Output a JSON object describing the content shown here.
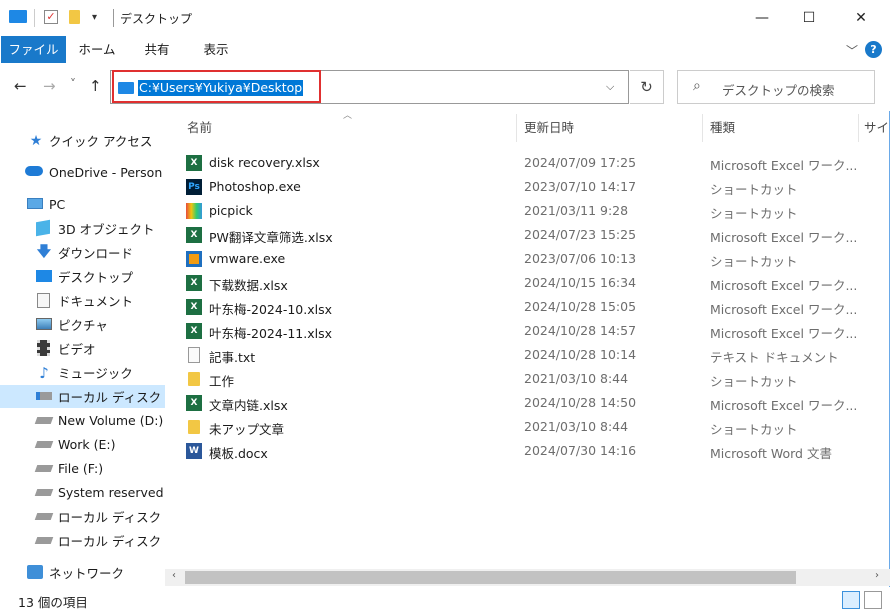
{
  "window": {
    "title": "デスクトップ",
    "minimize_glyph": "—",
    "maximize_glyph": "☐",
    "close_glyph": "✕"
  },
  "ribbon": {
    "tabs": [
      "ファイル",
      "ホーム",
      "共有",
      "表示"
    ],
    "collapse_glyph": "﹀",
    "help_glyph": "?"
  },
  "address": {
    "path": "C:¥Users¥Yukiya¥Desktop",
    "back_glyph": "←",
    "forward_glyph": "→",
    "recent_glyph": "˅",
    "up_glyph": "↑",
    "dropdown_glyph": "⌵",
    "refresh_glyph": "↻"
  },
  "search": {
    "placeholder": "デスクトップの検索",
    "icon_glyph": "⌕"
  },
  "nav_pane": {
    "items": [
      {
        "label": "クイック アクセス",
        "icon": "star-icon"
      },
      {
        "label": "OneDrive - Person",
        "icon": "cloud-icon"
      },
      {
        "label": "PC",
        "icon": "computer-icon"
      },
      {
        "label": "3D オブジェクト",
        "icon": "cube-icon"
      },
      {
        "label": "ダウンロード",
        "icon": "download-icon"
      },
      {
        "label": "デスクトップ",
        "icon": "desktop-icon"
      },
      {
        "label": "ドキュメント",
        "icon": "document-icon"
      },
      {
        "label": "ピクチャ",
        "icon": "picture-icon"
      },
      {
        "label": "ビデオ",
        "icon": "video-icon"
      },
      {
        "label": "ミュージック",
        "icon": "music-icon"
      },
      {
        "label": "ローカル ディスク (C",
        "icon": "drive-c-icon"
      },
      {
        "label": "New Volume (D:)",
        "icon": "drive-icon"
      },
      {
        "label": "Work (E:)",
        "icon": "drive-icon"
      },
      {
        "label": "File (F:)",
        "icon": "drive-icon"
      },
      {
        "label": "System reserved",
        "icon": "drive-icon"
      },
      {
        "label": "ローカル ディスク (H",
        "icon": "drive-icon"
      },
      {
        "label": "ローカル ディスク (I:",
        "icon": "drive-icon"
      },
      {
        "label": "ネットワーク",
        "icon": "network-icon"
      }
    ],
    "selected_index": 10
  },
  "columns": {
    "name": "名前",
    "date": "更新日時",
    "type": "種類",
    "size": "サイ"
  },
  "files": [
    {
      "name": "disk recovery.xlsx",
      "date": "2024/07/09 17:25",
      "type": "Microsoft Excel ワーク...",
      "icon": "excel-icon"
    },
    {
      "name": "Photoshop.exe",
      "date": "2023/07/10 14:17",
      "type": "ショートカット",
      "icon": "photoshop-icon"
    },
    {
      "name": "picpick",
      "date": "2021/03/11 9:28",
      "type": "ショートカット",
      "icon": "picpick-icon"
    },
    {
      "name": "PW翻译文章筛选.xlsx",
      "date": "2024/07/23 15:25",
      "type": "Microsoft Excel ワーク...",
      "icon": "excel-icon"
    },
    {
      "name": "vmware.exe",
      "date": "2023/07/06 10:13",
      "type": "ショートカット",
      "icon": "vmware-icon"
    },
    {
      "name": "下载数据.xlsx",
      "date": "2024/10/15 16:34",
      "type": "Microsoft Excel ワーク...",
      "icon": "excel-icon"
    },
    {
      "name": "叶东梅-2024-10.xlsx",
      "date": "2024/10/28 15:05",
      "type": "Microsoft Excel ワーク...",
      "icon": "excel-icon"
    },
    {
      "name": "叶东梅-2024-11.xlsx",
      "date": "2024/10/28 14:57",
      "type": "Microsoft Excel ワーク...",
      "icon": "excel-icon"
    },
    {
      "name": "記事.txt",
      "date": "2024/10/28 10:14",
      "type": "テキスト ドキュメント",
      "icon": "text-file-icon"
    },
    {
      "name": "工作",
      "date": "2021/03/10 8:44",
      "type": "ショートカット",
      "icon": "folder-shortcut-icon"
    },
    {
      "name": "文章内链.xlsx",
      "date": "2024/10/28 14:50",
      "type": "Microsoft Excel ワーク...",
      "icon": "excel-icon"
    },
    {
      "name": "未アップ文章",
      "date": "2021/03/10 8:44",
      "type": "ショートカット",
      "icon": "folder-shortcut-icon"
    },
    {
      "name": "模板.docx",
      "date": "2024/07/30 14:16",
      "type": "Microsoft Word 文書",
      "icon": "word-icon"
    }
  ],
  "status": {
    "text": "13 個の項目"
  },
  "colors": {
    "accent": "#1979ca",
    "selection": "#cce8ff",
    "highlight_border": "#e03030",
    "address_selection": "#0078d7",
    "excel": "#1d6f42",
    "word": "#2b579a"
  }
}
